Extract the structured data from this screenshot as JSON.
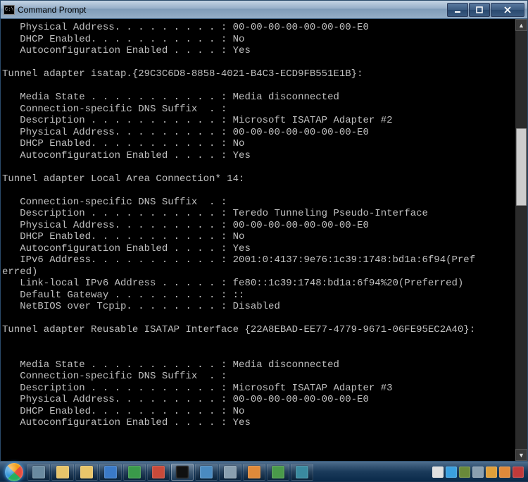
{
  "window": {
    "title": "Command Prompt"
  },
  "terminal": {
    "lines": [
      "   Physical Address. . . . . . . . . : 00-00-00-00-00-00-00-E0",
      "   DHCP Enabled. . . . . . . . . . . : No",
      "   Autoconfiguration Enabled . . . . : Yes",
      "",
      "Tunnel adapter isatap.{29C3C6D8-8858-4021-B4C3-ECD9FB551E1B}:",
      "",
      "   Media State . . . . . . . . . . . : Media disconnected",
      "   Connection-specific DNS Suffix  . :",
      "   Description . . . . . . . . . . . : Microsoft ISATAP Adapter #2",
      "   Physical Address. . . . . . . . . : 00-00-00-00-00-00-00-E0",
      "   DHCP Enabled. . . . . . . . . . . : No",
      "   Autoconfiguration Enabled . . . . : Yes",
      "",
      "Tunnel adapter Local Area Connection* 14:",
      "",
      "   Connection-specific DNS Suffix  . :",
      "   Description . . . . . . . . . . . : Teredo Tunneling Pseudo-Interface",
      "   Physical Address. . . . . . . . . : 00-00-00-00-00-00-00-E0",
      "   DHCP Enabled. . . . . . . . . . . : No",
      "   Autoconfiguration Enabled . . . . : Yes",
      "   IPv6 Address. . . . . . . . . . . : 2001:0:4137:9e76:1c39:1748:bd1a:6f94(Pref",
      "erred)",
      "   Link-local IPv6 Address . . . . . : fe80::1c39:1748:bd1a:6f94%20(Preferred)",
      "   Default Gateway . . . . . . . . . : ::",
      "   NetBIOS over Tcpip. . . . . . . . : Disabled",
      "",
      "Tunnel adapter Reusable ISATAP Interface {22A8EBAD-EE77-4779-9671-06FE95EC2A40}:",
      "",
      "",
      "   Media State . . . . . . . . . . . : Media disconnected",
      "   Connection-specific DNS Suffix  . :",
      "   Description . . . . . . . . . . . : Microsoft ISATAP Adapter #3",
      "   Physical Address. . . . . . . . . : 00-00-00-00-00-00-00-E0",
      "   DHCP Enabled. . . . . . . . . . . : No",
      "   Autoconfiguration Enabled . . . . : Yes"
    ]
  },
  "taskbar": {
    "items": [
      {
        "name": "recycle-bin",
        "color": "#6a8aa0"
      },
      {
        "name": "explorer",
        "color": "#e8c56a"
      },
      {
        "name": "folder",
        "color": "#e8c56a"
      },
      {
        "name": "ie",
        "color": "#3a7ac8"
      },
      {
        "name": "msn",
        "color": "#3a9a4a"
      },
      {
        "name": "app-red",
        "color": "#c84a3a"
      },
      {
        "name": "command-prompt",
        "color": "#101010",
        "active": true
      },
      {
        "name": "app-people",
        "color": "#4a8ac0"
      },
      {
        "name": "app-calc",
        "color": "#8aa0b0"
      },
      {
        "name": "app-wmp",
        "color": "#e08a3a"
      },
      {
        "name": "app-msg",
        "color": "#4a9a4a"
      },
      {
        "name": "app-other",
        "color": "#3a8aa0"
      }
    ],
    "tray": [
      {
        "name": "flag-icon",
        "color": "#e0e0e0"
      },
      {
        "name": "skype-icon",
        "color": "#3aa0e0"
      },
      {
        "name": "clock-icon",
        "color": "#6a8a3a"
      },
      {
        "name": "sound-icon",
        "color": "#8aa0b0"
      },
      {
        "name": "star-icon",
        "color": "#e0a03a"
      },
      {
        "name": "update-icon",
        "color": "#e08a3a"
      },
      {
        "name": "dev-icon",
        "color": "#c03a3a"
      }
    ]
  }
}
